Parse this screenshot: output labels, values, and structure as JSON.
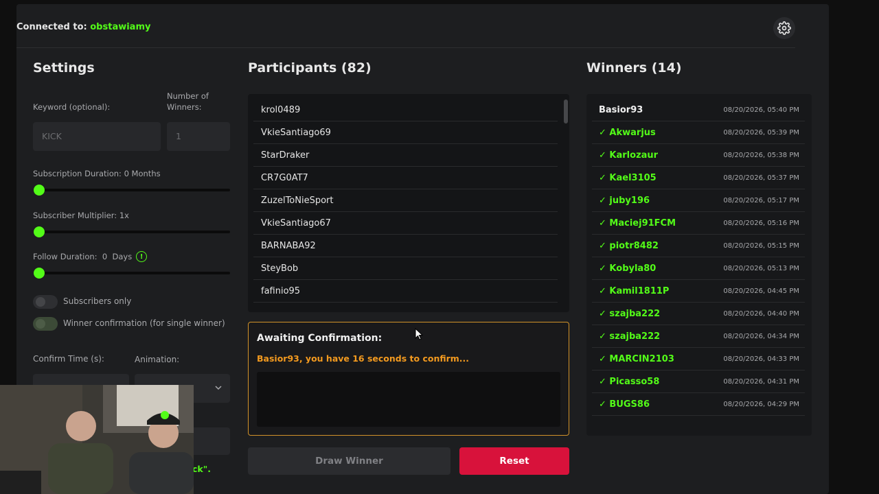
{
  "connection": {
    "prefix": "Connected to: ",
    "channel": "obstawiamy"
  },
  "settings": {
    "title": "Settings",
    "keyword_label": "Keyword (optional):",
    "keyword_placeholder": "KICK",
    "winners_label": "Number of Winners:",
    "winners_placeholder": "1",
    "sub_duration_label": "Subscription Duration: 0 Months",
    "sub_multiplier_label": "Subscriber Multiplier: 1x",
    "follow_duration_label": "Follow Duration:  0  Days",
    "subscribers_only_label": "Subscribers only",
    "winner_confirmation_label": "Winner confirmation (for single winner)",
    "confirm_time_label": "Confirm Time (s):",
    "animation_label": "Animation:",
    "partial_text": "ck\"."
  },
  "participants": {
    "title": "Participants (82)",
    "items": [
      "krol0489",
      "VkieSantiago69",
      "StarDraker",
      "CR7G0AT7",
      "ZuzelToNieSport",
      "VkieSantiago67",
      "BARNABA92",
      "SteyBob",
      "fafinio95"
    ]
  },
  "confirmation": {
    "title": "Awaiting Confirmation:",
    "message": "Basior93, you have 16 seconds to confirm..."
  },
  "buttons": {
    "draw": "Draw Winner",
    "reset": "Reset"
  },
  "winners": {
    "title": "Winners (14)",
    "items": [
      {
        "name": "Basior93",
        "time": "08/20/2026, 05:40 PM"
      },
      {
        "name": "✓ Akwarjus",
        "time": "08/20/2026, 05:39 PM"
      },
      {
        "name": "✓ Karlozaur",
        "time": "08/20/2026, 05:38 PM"
      },
      {
        "name": "✓ Kael3105",
        "time": "08/20/2026, 05:37 PM"
      },
      {
        "name": "✓ juby196",
        "time": "08/20/2026, 05:17 PM"
      },
      {
        "name": "✓ Maciej91FCM",
        "time": "08/20/2026, 05:16 PM"
      },
      {
        "name": "✓ piotr8482",
        "time": "08/20/2026, 05:15 PM"
      },
      {
        "name": "✓ Kobyla80",
        "time": "08/20/2026, 05:13 PM"
      },
      {
        "name": "✓ Kamil1811P",
        "time": "08/20/2026, 04:45 PM"
      },
      {
        "name": "✓ szajba222",
        "time": "08/20/2026, 04:40 PM"
      },
      {
        "name": "✓ szajba222",
        "time": "08/20/2026, 04:34 PM"
      },
      {
        "name": "✓ MARCIN2103",
        "time": "08/20/2026, 04:33 PM"
      },
      {
        "name": "✓ Picasso58",
        "time": "08/20/2026, 04:31 PM"
      },
      {
        "name": "✓ BUGS86",
        "time": "08/20/2026, 04:29 PM"
      }
    ]
  },
  "colors": {
    "accent": "#53fc18",
    "warning": "#f39a1f",
    "danger": "#d8123b"
  }
}
